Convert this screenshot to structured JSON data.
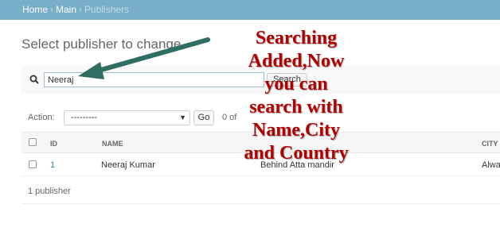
{
  "breadcrumbs": {
    "home": "Home",
    "main": "Main",
    "current": "Publishers",
    "separator": "›"
  },
  "page": {
    "title": "Select publisher to change"
  },
  "search": {
    "value": "Neeraj",
    "button_label": "Search"
  },
  "actions": {
    "label": "Action:",
    "selected": "---------",
    "go_label": "Go",
    "selection_text": "0 of"
  },
  "table": {
    "headers": {
      "id": "ID",
      "name": "NAME",
      "city": "CITY"
    },
    "rows": [
      {
        "id": "1",
        "name": "Neeraj Kumar",
        "address": "Behind Atta mandir",
        "city": "Alwa"
      }
    ]
  },
  "footer": {
    "result_count": "1 publisher"
  },
  "annotation": {
    "lines": [
      "Searching",
      "Added,Now",
      "you can",
      "search with",
      "Name,City",
      "and Country"
    ],
    "text_color": "#b00000",
    "arrow_color": "#2f6e62"
  },
  "colors": {
    "breadcrumb_bg": "#79aec8",
    "link": "#447e9b"
  }
}
